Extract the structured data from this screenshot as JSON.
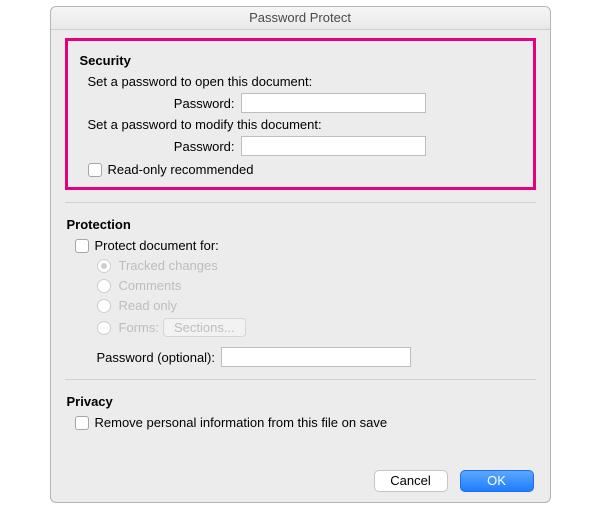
{
  "window": {
    "title": "Password Protect"
  },
  "security": {
    "heading": "Security",
    "open_instruction": "Set a password to open this document:",
    "open_password_label": "Password:",
    "open_password_value": "",
    "modify_instruction": "Set a password to modify this document:",
    "modify_password_label": "Password:",
    "modify_password_value": "",
    "read_only_label": "Read-only recommended",
    "read_only_checked": false
  },
  "protection": {
    "heading": "Protection",
    "protect_for_label": "Protect document for:",
    "protect_for_checked": false,
    "options": {
      "tracked_changes": "Tracked changes",
      "comments": "Comments",
      "read_only": "Read only",
      "forms": "Forms:",
      "sections_button": "Sections..."
    },
    "selected_option": "tracked_changes",
    "optional_password_label": "Password (optional):",
    "optional_password_value": ""
  },
  "privacy": {
    "heading": "Privacy",
    "remove_info_label": "Remove personal information from this file on save",
    "remove_info_checked": false
  },
  "buttons": {
    "cancel": "Cancel",
    "ok": "OK"
  }
}
